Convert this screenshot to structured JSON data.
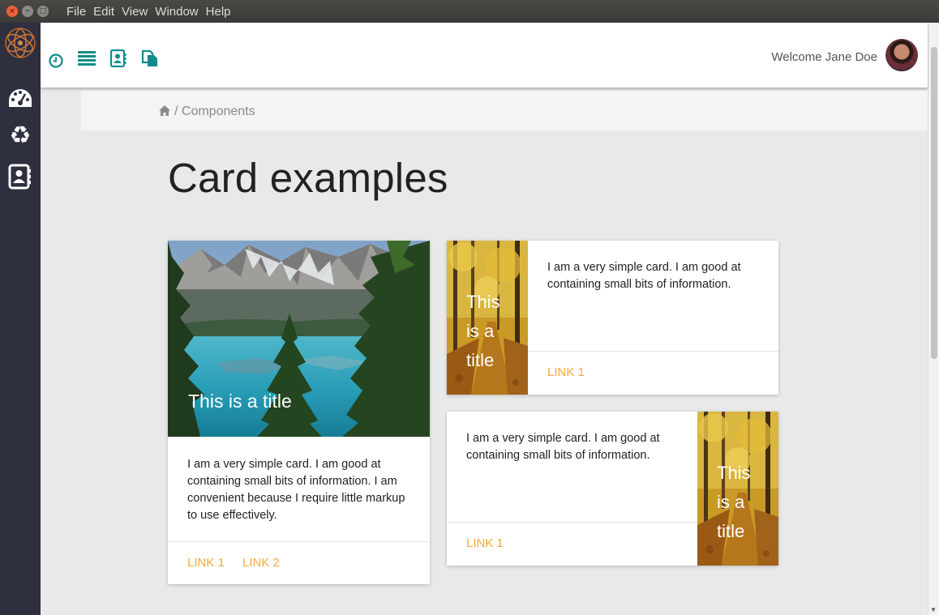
{
  "menu": [
    "File",
    "Edit",
    "View",
    "Window",
    "Help"
  ],
  "window_buttons": {
    "close": "×",
    "minimize": "−",
    "maximize": "□"
  },
  "sidebar": {
    "logo": "atom-logo",
    "items": [
      {
        "icon": "dashboard-gauge-icon"
      },
      {
        "icon": "recycle-icon"
      },
      {
        "icon": "contact-book-icon"
      }
    ]
  },
  "topbar": {
    "icons": [
      "clock-icon",
      "list-icon",
      "address-book-icon",
      "documents-icon"
    ],
    "welcome": "Welcome Jane Doe",
    "accent_color": "#0e8c8c"
  },
  "breadcrumb": {
    "home_icon": "home-icon",
    "text": "/ Components"
  },
  "page": {
    "title": "Card examples"
  },
  "cards": {
    "big": {
      "title": "This is a title",
      "text": "I am a very simple card. I am good at containing small bits of information. I am convenient because I require little markup to use effectively.",
      "link1": "LINK 1",
      "link2": "LINK 2"
    },
    "horizontal1": {
      "title_lines": [
        "This",
        "is a",
        "title"
      ],
      "text": "I am a very simple card. I am good at containing small bits of information.",
      "link1": "LINK 1"
    },
    "horizontal2": {
      "title_lines": [
        "This",
        "is a",
        "title"
      ],
      "text": "I am a very simple card. I am good at containing small bits of information.",
      "link1": "LINK 1"
    },
    "link_color": "#f4a93b"
  }
}
